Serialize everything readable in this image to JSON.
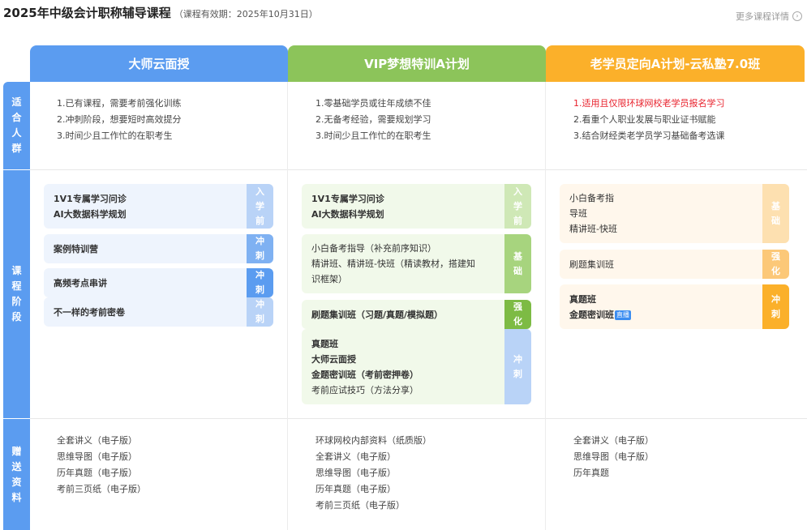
{
  "header": {
    "title": "2025年中级会计职称辅导课程",
    "validity": "（课程有效期：2025年10月31日）",
    "more_link": "更多课程详情"
  },
  "columns": [
    {
      "title": "大师云面授",
      "color": "#5b9cf0"
    },
    {
      "title": "VIP梦想特训A计划",
      "color": "#8cc45a"
    },
    {
      "title": "老学员定向A计划-云私塾7.0班",
      "color": "#fbb02a"
    }
  ],
  "rows": {
    "audience": "适合人群",
    "stages": "课程阶段",
    "materials": "赠送资料"
  },
  "audience": {
    "col1": [
      "1.已有课程，需要考前强化训练",
      "2.冲刺阶段，想要短时高效提分",
      "3.时间少且工作忙的在职考生"
    ],
    "col2": [
      "1.零基础学员或往年成绩不佳",
      "2.无备考经验，需要规划学习",
      "3.时间少且工作忙的在职考生"
    ],
    "col3": [
      "1.适用且仅限环球网校老学员报名学习",
      "2.看重个人职业发展与职业证书赋能",
      "3.结合财经类老学员学习基础备考选课"
    ]
  },
  "stages": {
    "col1": [
      {
        "lines": [
          "1V1专属学习问诊",
          "AI大数据科学规划"
        ],
        "tag": "入学前"
      },
      {
        "lines": [
          "案例特训营"
        ],
        "tag": "冲刺"
      },
      {
        "lines": [
          "高频考点串讲"
        ],
        "tag": "冲刺"
      },
      {
        "lines": [
          "不一样的考前密卷"
        ],
        "tag": "冲刺"
      }
    ],
    "col2": [
      {
        "lines": [
          "1V1专属学习问诊",
          "AI大数据科学规划"
        ],
        "tag": "入学前"
      },
      {
        "lines": [
          "小白备考指导（补充前序知识）",
          "精讲班、精讲班-快班（精读教材，搭建知",
          "识框架）"
        ],
        "tag": "基础"
      },
      {
        "lines": [
          "刷题集训班（习题/真题/模拟题）"
        ],
        "tag": "强化"
      },
      {
        "lines": [
          "真题班",
          "大师云面授",
          "金题密训班（考前密押卷）",
          "考前应试技巧（方法分享）"
        ],
        "tag": "冲刺"
      }
    ],
    "col3": [
      {
        "lines": [
          "小白备考指",
          "导班",
          "精讲班-快班"
        ],
        "tag": "基础"
      },
      {
        "lines": [
          "刷题集训班"
        ],
        "tag": "强化"
      },
      {
        "lines": [
          "真题班",
          "金题密训班"
        ],
        "tag": "冲刺",
        "badge": "直播"
      }
    ]
  },
  "materials": {
    "col1": [
      "全套讲义（电子版）",
      "思维导图（电子版）",
      "历年真题（电子版）",
      "考前三页纸（电子版）"
    ],
    "col2": [
      "环球网校内部资料（纸质版）",
      "全套讲义（电子版）",
      "思维导图（电子版）",
      "历年真题（电子版）",
      "考前三页纸（电子版）"
    ],
    "col3": [
      "全套讲义（电子版）",
      "思维导图（电子版）",
      "历年真题"
    ]
  },
  "colors": {
    "blue": "#5b9cf0",
    "green": "#8cc45a",
    "orange": "#fbb02a",
    "highlight_red": "#e8202b"
  }
}
